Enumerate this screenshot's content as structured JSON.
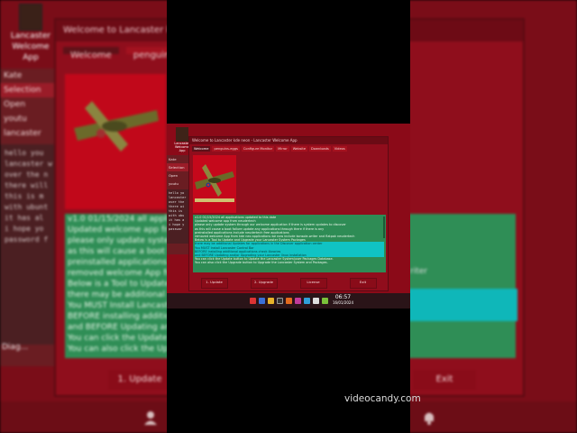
{
  "background": {
    "desktop_icon_label": "Lancaster\nWelcome App",
    "file_manager": {
      "user": "Kate",
      "items": [
        "Selection",
        "Open",
        "youtu",
        "lancaster"
      ]
    },
    "terminal_lines": [
      "hello you",
      "lancaster w",
      "over the n",
      "there will",
      "this is m",
      "with ubunt",
      "it has al",
      "i hope yo",
      "",
      "password f"
    ],
    "window_title": "Welcome to Lancaster kde neo...",
    "tabs": [
      "Welcome",
      "penguins-eggs"
    ],
    "text_lines": [
      "v1.0 01/15/2024 all applications",
      "Updated welcome app from h",
      "please only update system thr",
      "as this will cause a boot failure",
      "preinstalled applications inclu",
      "removed welcome App from l",
      "Below is a Tool to Update and",
      "there may be additional Upda",
      "You MUST Install Lancaster C",
      "BEFORE installing additional a",
      "and BEFORE Updating and/or",
      "",
      "You can click the Update butt",
      "You can also click the Upgrade"
    ],
    "buttons": [
      "1. Update",
      "Exit"
    ],
    "side_label": "Diag...",
    "right_label": "riter"
  },
  "app": {
    "desktop_icon_label": "Lancaster Welcome App",
    "file_manager": {
      "user": "Kate",
      "items": [
        "Selection",
        "Open",
        "youtu"
      ]
    },
    "terminal_lines": [
      "hello yo",
      "lancaster",
      "over the",
      "there wi",
      "this is",
      "with ubu",
      "it has a",
      "i hope y",
      "",
      "passwor"
    ],
    "window_title": "Welcome to Lancaster kde neon - Lancaster Welcome App",
    "tabs": [
      {
        "label": "Welcome",
        "active": true
      },
      {
        "label": "penguins-eggs",
        "active": false
      },
      {
        "label": "Configure Monitor",
        "active": false
      },
      {
        "label": "Mirror",
        "active": false
      },
      {
        "label": "Website",
        "active": false
      },
      {
        "label": "Downloads",
        "active": false
      },
      {
        "label": "Videos",
        "active": false
      }
    ],
    "text_lines": [
      {
        "t": "v1.0 01/15/2024 all applications updated to this date",
        "hl": false
      },
      {
        "t": "Updated welcome app from neudertech",
        "hl": false
      },
      {
        "t": "please only update system through our welcome application if there is system updates to discover",
        "hl": false
      },
      {
        "t": "as this will cause a boot failure update any applications through there if there is any",
        "hl": false
      },
      {
        "t": "preinstalled applications include neudertech free applications",
        "hl": false
      },
      {
        "t": "removed welcome App from kde neo applications we now include konsole-writer and flatpak neudertech",
        "hl": false
      },
      {
        "t": "Below is a Tool to Update and Upgrade your Lancaster System Packages",
        "hl": false
      },
      {
        "t": "there may be additional Updates for applications in the Discover application center",
        "hl": true
      },
      {
        "t": "You MUST Install Lancaster Control Bar",
        "hl": true
      },
      {
        "t": "BEFORE installing additional applications check libraries",
        "hl": true
      },
      {
        "t": "and BEFORE Updating and/or Upgrading your Lancaster linux installation",
        "hl": true
      },
      {
        "t": "",
        "hl": false
      },
      {
        "t": "You can click the Update button to Update the Lancaster System/user Packages Database.",
        "hl": false
      },
      {
        "t": "You can also click the Upgrade button to Upgrade the Lancaster System and Packages.",
        "hl": false
      }
    ],
    "buttons": [
      "1. Update",
      "2. Upgrade",
      "License",
      "Exit"
    ],
    "clock_time": "06:57",
    "clock_date": "16/01/2024"
  },
  "watermark": "videocandy.com",
  "colors": {
    "desktop_red": "#8b0a18",
    "text_green": "#2e8c55",
    "highlight_cyan": "#10c3c4",
    "plane_bg": "#c5081b"
  },
  "icons": [
    "plane-artwork",
    "home-icon",
    "folder-icon",
    "terminal-icon",
    "browser-icon",
    "user-icon",
    "bell-icon"
  ]
}
